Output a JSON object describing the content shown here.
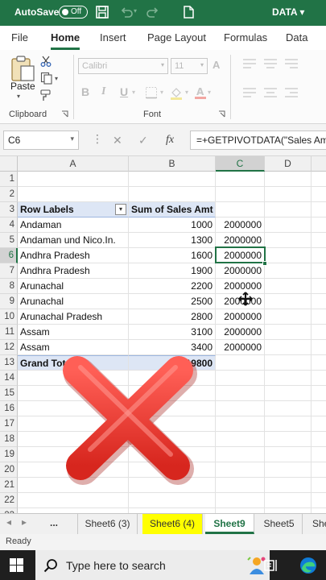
{
  "title_bar": {
    "autosave_label": "AutoSave",
    "autosave_state": "Off",
    "document_name": "DATA ▾"
  },
  "ribbon": {
    "tabs": [
      "File",
      "Home",
      "Insert",
      "Page Layout",
      "Formulas",
      "Data"
    ],
    "active_tab": "Home",
    "groups": {
      "clipboard_label": "Clipboard",
      "font_label": "Font",
      "paste_label": "Paste",
      "font_name": "Calibri",
      "font_size": "11"
    }
  },
  "formula_bar": {
    "name_box": "C6",
    "fx": "fx",
    "formula": "=+GETPIVOTDATA(\"Sales Amt\""
  },
  "columns": [
    "A",
    "B",
    "C",
    "D"
  ],
  "rows": [
    {
      "n": "1",
      "a": "",
      "b": "",
      "c": ""
    },
    {
      "n": "2",
      "a": "",
      "b": "",
      "c": ""
    },
    {
      "n": "3",
      "a": "Row Labels",
      "b": "Sum of Sales Amt",
      "c": ""
    },
    {
      "n": "4",
      "a": "Andaman",
      "b": "1000",
      "c": "2000000"
    },
    {
      "n": "5",
      "a": "Andaman und Nico.In.",
      "b": "1300",
      "c": "2000000"
    },
    {
      "n": "6",
      "a": "Andhra Pradesh",
      "b": "1600",
      "c": "2000000"
    },
    {
      "n": "7",
      "a": "Andhra Pradesh",
      "b": "1900",
      "c": "2000000"
    },
    {
      "n": "8",
      "a": "Arunachal",
      "b": "2200",
      "c": "2000000"
    },
    {
      "n": "9",
      "a": "Arunachal",
      "b": "2500",
      "c": "2000000"
    },
    {
      "n": "10",
      "a": "Arunachal Pradesh",
      "b": "2800",
      "c": "2000000"
    },
    {
      "n": "11",
      "a": "Assam",
      "b": "3100",
      "c": "2000000"
    },
    {
      "n": "12",
      "a": "Assam",
      "b": "3400",
      "c": "2000000"
    },
    {
      "n": "13",
      "a": "Grand Total",
      "b": "19800",
      "c": ""
    },
    {
      "n": "14",
      "a": "",
      "b": "",
      "c": ""
    },
    {
      "n": "15",
      "a": "",
      "b": "",
      "c": ""
    },
    {
      "n": "16",
      "a": "",
      "b": "",
      "c": ""
    },
    {
      "n": "17",
      "a": "",
      "b": "",
      "c": ""
    },
    {
      "n": "18",
      "a": "",
      "b": "",
      "c": ""
    },
    {
      "n": "19",
      "a": "",
      "b": "",
      "c": ""
    },
    {
      "n": "20",
      "a": "",
      "b": "",
      "c": ""
    },
    {
      "n": "21",
      "a": "",
      "b": "",
      "c": ""
    },
    {
      "n": "22",
      "a": "",
      "b": "",
      "c": ""
    },
    {
      "n": "23",
      "a": "",
      "b": "",
      "c": ""
    }
  ],
  "sheet_tabs": {
    "ellipsis": "...",
    "tabs": [
      "Sheet6 (3)",
      "Sheet6 (4)",
      "Sheet9",
      "Sheet5",
      "She"
    ],
    "active": "Sheet9",
    "highlighted": "Sheet6 (4)"
  },
  "status_bar": {
    "text": "Ready"
  },
  "taskbar": {
    "search_placeholder": "Type here to search"
  },
  "colors": {
    "excel_green": "#217346",
    "pivot_header": "#dde6f5",
    "highlight_tab": "#ffff00",
    "overlay_x": "#e8342a"
  }
}
